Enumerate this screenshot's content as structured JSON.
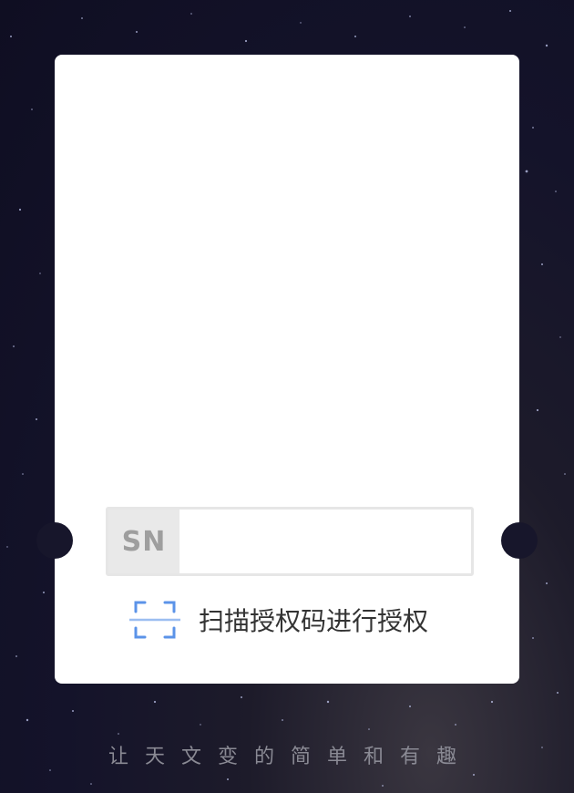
{
  "sn_field": {
    "label": "SN",
    "value": "",
    "placeholder": ""
  },
  "scan": {
    "icon": "scan-qr-icon",
    "label": "扫描授权码进行授权",
    "accent_color": "#5b93e8"
  },
  "footer": {
    "slogan": "让天文变的简单和有趣"
  },
  "colors": {
    "card": "#ffffff",
    "background": "#14132a"
  }
}
